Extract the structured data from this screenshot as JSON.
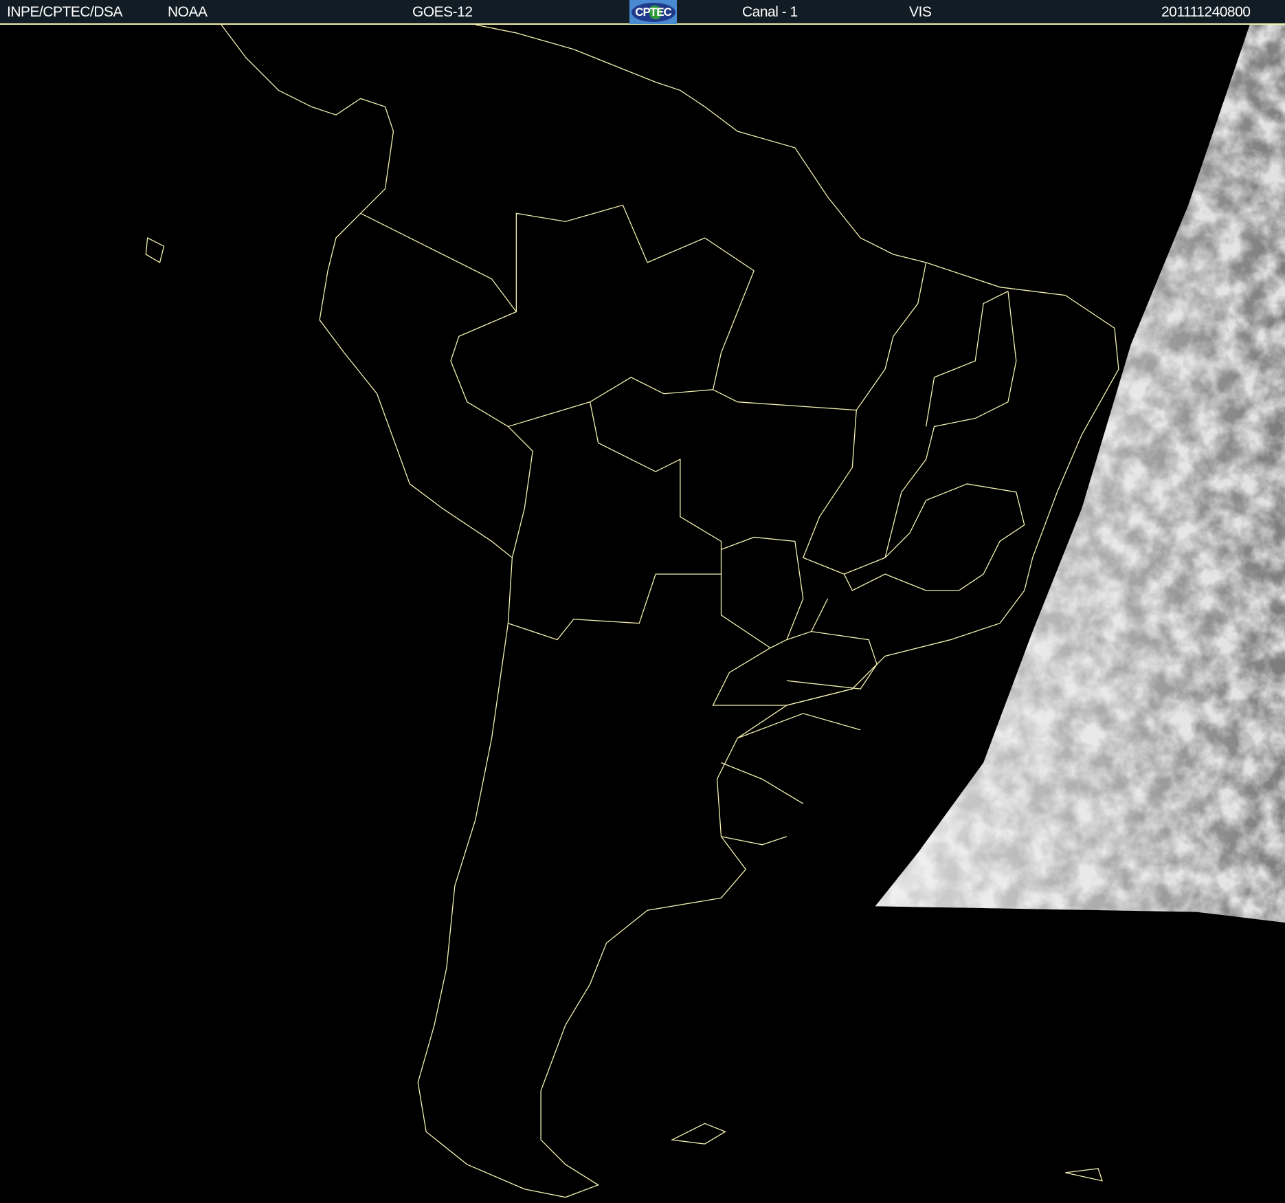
{
  "header": {
    "institution": "INPE/CPTEC/DSA",
    "agency": "NOAA",
    "satellite": "GOES-12",
    "logo_text": "CPTEC",
    "channel": "Canal - 1",
    "band": "VIS",
    "timestamp": "201111240800"
  },
  "colors": {
    "header_bg": "#111c24",
    "coastline": "#f2f0b0",
    "background": "#000000"
  }
}
